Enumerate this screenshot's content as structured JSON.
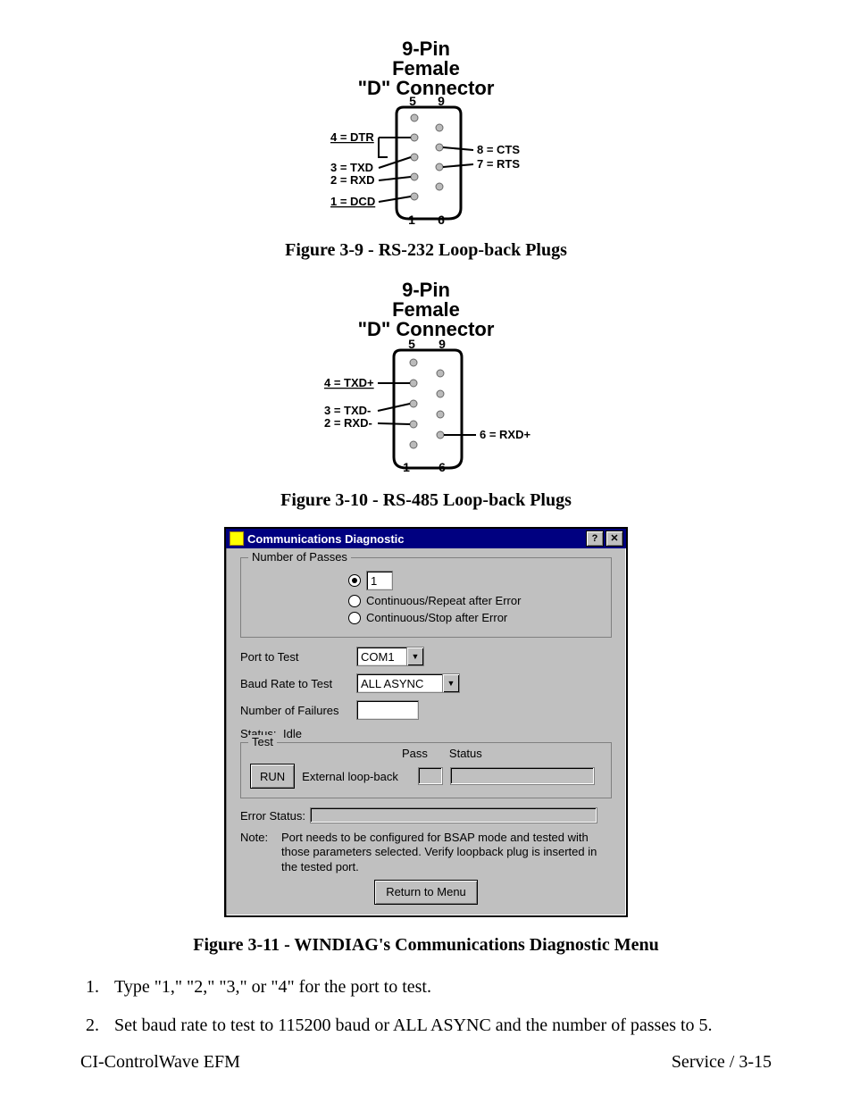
{
  "conn1": {
    "title_line1": "9-Pin",
    "title_line2": "Female",
    "title_line3": "\"D\" Connector",
    "pin_top_left": "5",
    "pin_top_right": "9",
    "pin_bot_left": "1",
    "pin_bot_right": "6",
    "left_labels": [
      "4 = DTR",
      "3 = TXD",
      "2 = RXD",
      "1 = DCD"
    ],
    "right_labels": [
      "8 = CTS",
      "7 = RTS"
    ]
  },
  "figcap1": "Figure 3-9 - RS-232 Loop-back Plugs",
  "conn2": {
    "title_line1": "9-Pin",
    "title_line2": "Female",
    "title_line3": "\"D\" Connector",
    "pin_top_left": "5",
    "pin_top_right": "9",
    "pin_bot_left": "1",
    "pin_bot_right": "6",
    "left_labels": [
      "4 = TXD+",
      "3 = TXD-",
      "2 = RXD-"
    ],
    "right_labels": [
      "6 = RXD+"
    ]
  },
  "figcap2": "Figure 3-10 - RS-485 Loop-back Plugs",
  "dialog": {
    "title": "Communications Diagnostic",
    "help_btn": "?",
    "close_btn": "✕",
    "group_passes_legend": "Number of Passes",
    "passes_value": "1",
    "radio_continuous_repeat": "Continuous/Repeat after Error",
    "radio_continuous_stop": "Continuous/Stop after  Error",
    "port_label": "Port to Test",
    "port_value": "COM1",
    "baud_label": "Baud Rate to Test",
    "baud_value": "ALL ASYNC",
    "failures_label": "Number of Failures",
    "status_label": "Status:",
    "status_value": "Idle",
    "group_test_legend": "Test",
    "col_pass": "Pass",
    "col_status": "Status",
    "run_btn": "RUN",
    "run_label": "External loop-back",
    "error_status_label": "Error Status:",
    "note_label": "Note:",
    "note_text": "Port needs to be configured for BSAP mode and tested with those parameters selected. Verify loopback plug is inserted in the tested port.",
    "return_btn": "Return to Menu"
  },
  "figcap3": "Figure 3-11 - WINDIAG's Communications Diagnostic Menu",
  "steps": [
    "Type \"1,\" \"2,\" \"3,\" or \"4\" for the port to test.",
    "Set baud rate to test to 115200 baud or ALL ASYNC and the number of passes to 5."
  ],
  "footer_left": "CI-ControlWave EFM",
  "footer_right": "Service / 3-15"
}
